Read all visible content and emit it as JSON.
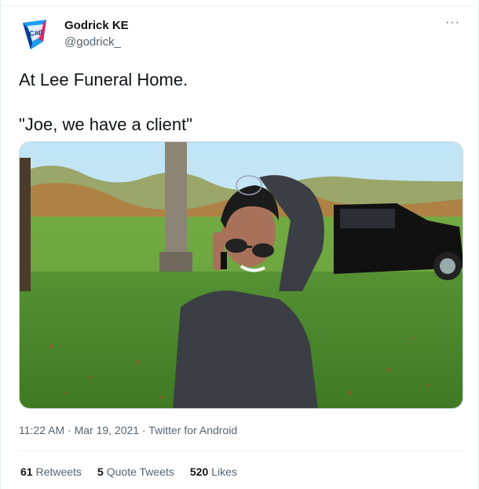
{
  "tweet": {
    "author_name": "Godrick KE",
    "author_handle": "@godrick_",
    "more_icon": "more-horizontal-icon",
    "text_line1": "At Lee Funeral Home.",
    "text_line2": "\"Joe, we have a client\"",
    "time": "11:22 AM",
    "sep1": " · ",
    "date": "Mar 19, 2021",
    "sep2": " · ",
    "source": "Twitter for Android",
    "retweets_count": "61",
    "retweets_label": "Retweets",
    "quotes_count": "5",
    "quotes_label": "Quote Tweets",
    "likes_count": "520",
    "likes_label": "Likes"
  },
  "colors": {
    "text_primary": "#0f1419",
    "text_secondary": "#536471",
    "border": "#eff3f4"
  }
}
